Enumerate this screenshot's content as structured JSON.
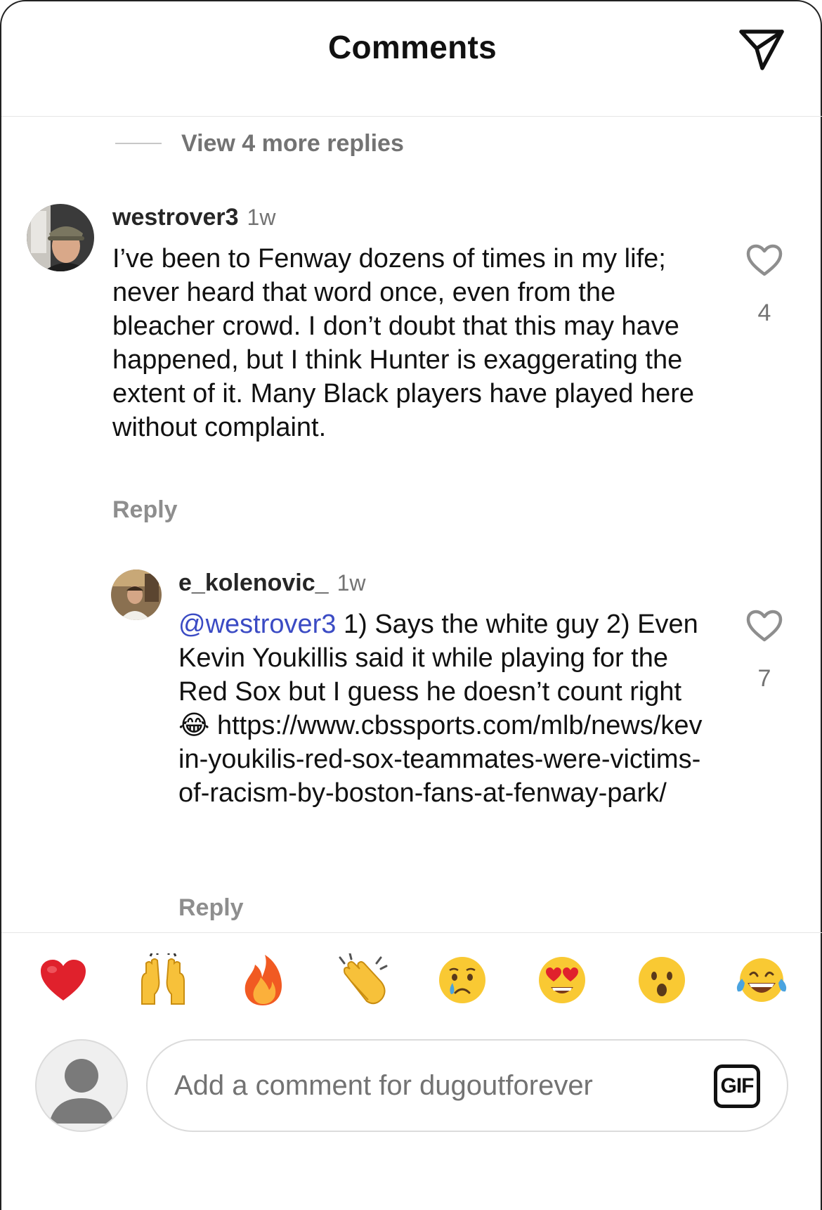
{
  "header": {
    "title": "Comments",
    "share_icon": "paper-plane-icon"
  },
  "thread": {
    "view_more_replies": "View 4 more replies"
  },
  "comments": [
    {
      "username": "westrover3",
      "time": "1w",
      "text": "I’ve been to Fenway dozens of times in my life; never heard that word once, even from the bleacher crowd. I don’t doubt that this may have happened, but I think Hunter is exaggerating the extent of it. Many Black players have played here without complaint.",
      "reply_label": "Reply",
      "likes": "4",
      "like_icon": "heart-outline-icon"
    },
    {
      "username": "e_kolenovic_",
      "time": "1w",
      "mention": "@westrover3",
      "text_before_emoji": " 1) Says the white guy 2) Even Kevin Youkillis said it while playing for the Red Sox but I guess he doesn’t count right ",
      "emoji": "😂",
      "text_after_emoji": " https://www.cbssports.com/mlb/news/kevin-youkilis-red-sox-teammates-were-victims-of-racism-by-boston-fans-at-fenway-park/",
      "reply_label": "Reply",
      "likes": "7",
      "like_icon": "heart-outline-icon"
    }
  ],
  "reactions": [
    {
      "name": "red-heart-emoji",
      "glyph": "❤️"
    },
    {
      "name": "raising-hands-emoji",
      "glyph": "🙌"
    },
    {
      "name": "fire-emoji",
      "glyph": "🔥"
    },
    {
      "name": "clapping-hands-emoji",
      "glyph": "👏"
    },
    {
      "name": "crying-face-emoji",
      "glyph": "😢"
    },
    {
      "name": "heart-eyes-emoji",
      "glyph": "😍"
    },
    {
      "name": "surprised-face-emoji",
      "glyph": "😮"
    },
    {
      "name": "tears-of-joy-emoji",
      "glyph": "😂"
    }
  ],
  "composer": {
    "placeholder": "Add a comment for dugoutforever",
    "gif_label": "GIF"
  },
  "colors": {
    "mention": "#3b4bc4",
    "secondary_text": "#737373"
  }
}
